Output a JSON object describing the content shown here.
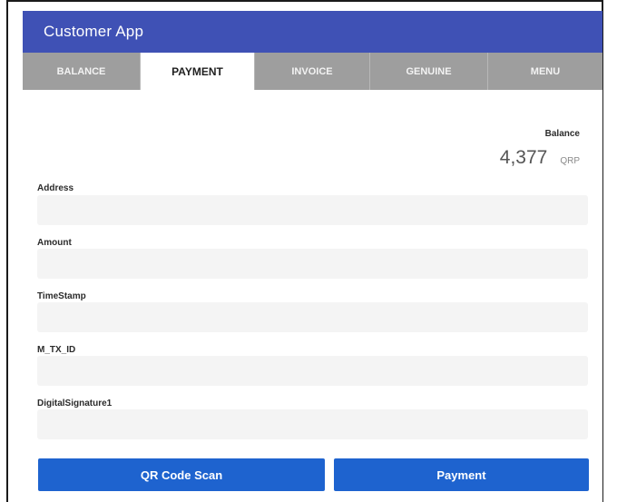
{
  "app": {
    "title": "Customer App",
    "accent_color": "#3f51b5"
  },
  "tabs": [
    {
      "label": "BALANCE",
      "active": false
    },
    {
      "label": "PAYMENT",
      "active": true
    },
    {
      "label": "INVOICE",
      "active": false
    },
    {
      "label": "GENUINE",
      "active": false
    },
    {
      "label": "MENU",
      "active": false
    }
  ],
  "balance": {
    "label": "Balance",
    "value": "4,377",
    "unit": "QRP"
  },
  "form": {
    "fields": [
      {
        "label": "Address",
        "value": ""
      },
      {
        "label": "Amount",
        "value": ""
      },
      {
        "label": "TimeStamp",
        "value": ""
      },
      {
        "label": "M_TX_ID",
        "value": ""
      },
      {
        "label": "DigitalSignature1",
        "value": ""
      }
    ]
  },
  "buttons": {
    "qr_scan": "QR Code Scan",
    "payment": "Payment",
    "color": "#1e63cf"
  }
}
